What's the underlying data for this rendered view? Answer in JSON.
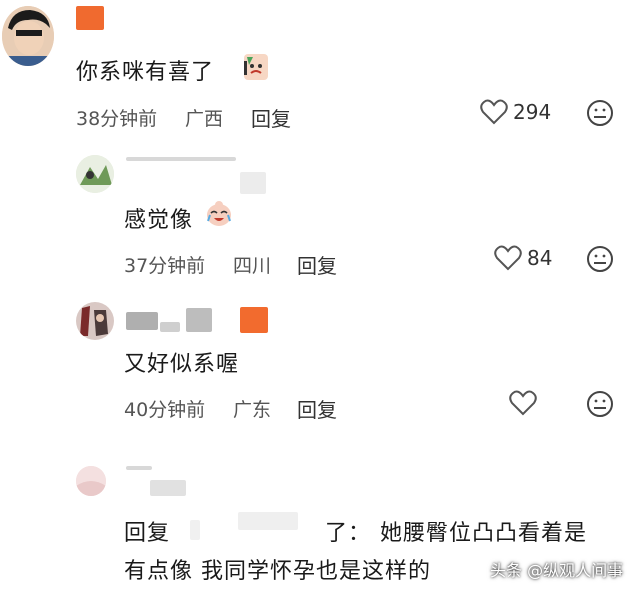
{
  "comments": [
    {
      "text": "你系咪有喜了",
      "time": "38分钟前",
      "region": "广西",
      "reply_label": "回复",
      "likes": "294"
    },
    {
      "text": "感觉像",
      "time": "37分钟前",
      "region": "四川",
      "reply_label": "回复",
      "likes": "84"
    },
    {
      "text": "又好似系喔",
      "time": "40分钟前",
      "region": "广东",
      "reply_label": "回复",
      "likes": ""
    }
  ],
  "reply_comment": {
    "prefix": "回复",
    "separator": "了：",
    "text_line1": "她腰臀位凸凸看着是",
    "text_line2": "有点像 我同学怀孕也是这样的"
  },
  "watermark": "头条 @纵观人间事",
  "colors": {
    "like_icon": "#555555",
    "badge_orange": "#f26b2e",
    "page_bg": "#ffffff"
  },
  "icons": [
    "heart-icon",
    "neutral-face-icon"
  ]
}
